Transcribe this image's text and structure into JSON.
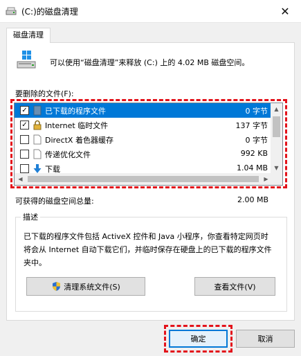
{
  "window": {
    "title": "(C:)的磁盘清理",
    "close_glyph": "✕"
  },
  "tab": {
    "label": "磁盘清理"
  },
  "summary": {
    "text": "可以使用“磁盘清理”来释放  (C:) 上的 4.02 MB 磁盘空间。"
  },
  "files_label": "要删除的文件(F):",
  "files": [
    {
      "name": "已下载的程序文件",
      "size": "0 字节",
      "checked": true,
      "selected": true,
      "icon": "folder-icon"
    },
    {
      "name": "Internet 临时文件",
      "size": "137 字节",
      "checked": true,
      "selected": false,
      "icon": "lock-icon"
    },
    {
      "name": "DirectX 着色器缓存",
      "size": "0 字节",
      "checked": false,
      "selected": false,
      "icon": "file-icon"
    },
    {
      "name": "传递优化文件",
      "size": "992 KB",
      "checked": false,
      "selected": false,
      "icon": "file-icon"
    },
    {
      "name": "下载",
      "size": "1.04 MB",
      "checked": false,
      "selected": false,
      "icon": "download-icon"
    }
  ],
  "check_glyph": "✓",
  "total": {
    "label": "可获得的磁盘空间总量:",
    "value": "2.00 MB"
  },
  "description": {
    "title": "描述",
    "text": "已下载的程序文件包括 ActiveX 控件和 Java 小程序，你查看特定网页时将会从 Internet 自动下载它们，并临时保存在硬盘上的已下载的程序文件夹中。"
  },
  "buttons": {
    "cleanup_system": "清理系统文件(S)",
    "view_files": "查看文件(V)",
    "ok": "确定",
    "cancel": "取消"
  },
  "colors": {
    "selection": "#0078d7",
    "highlight_dashes": "#e3121a"
  }
}
